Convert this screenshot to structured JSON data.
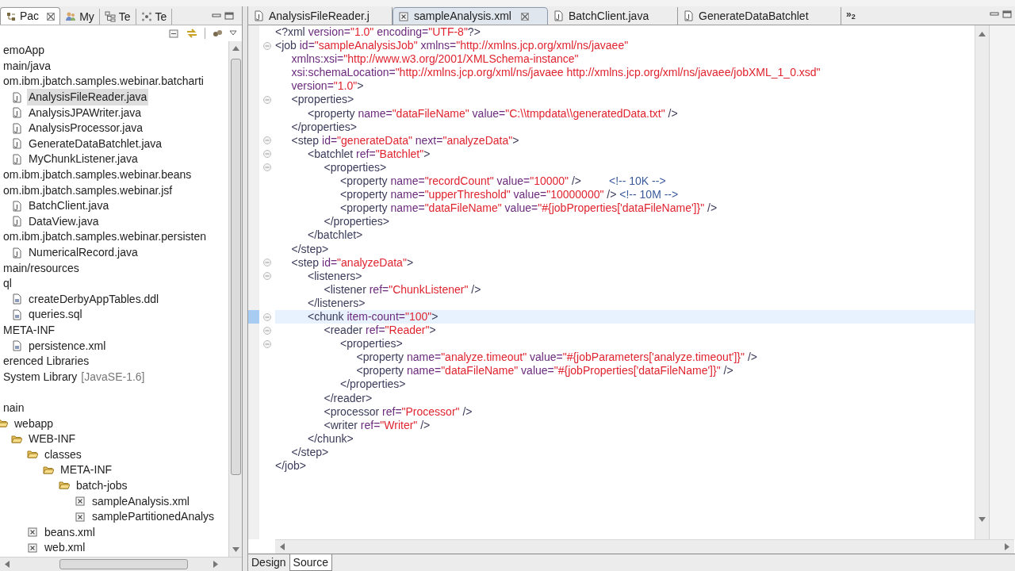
{
  "explorer": {
    "tabs": [
      {
        "label": "Pac",
        "kind": "package",
        "selected": true
      },
      {
        "label": "My",
        "kind": "people",
        "selected": false
      },
      {
        "label": "Te",
        "kind": "hierarchy",
        "selected": false
      },
      {
        "label": "Te",
        "kind": "nodes",
        "selected": false
      }
    ],
    "tree": [
      {
        "text": "emoApp",
        "kind": "plain",
        "selected": false,
        "children": [
          {
            "text": "main/java",
            "kind": "plain",
            "selected": false,
            "children": [
              {
                "text": "om.ibm.jbatch.samples.webinar.batcharti",
                "kind": "plain",
                "selected": false,
                "children": [
                  {
                    "text": "AnalysisFileReader.java",
                    "kind": "java",
                    "selected": true
                  },
                  {
                    "text": "AnalysisJPAWriter.java",
                    "kind": "java",
                    "selected": false
                  },
                  {
                    "text": "AnalysisProcessor.java",
                    "kind": "java",
                    "selected": false
                  },
                  {
                    "text": "GenerateDataBatchlet.java",
                    "kind": "java",
                    "selected": false
                  },
                  {
                    "text": "MyChunkListener.java",
                    "kind": "java",
                    "selected": false
                  }
                ]
              },
              {
                "text": "om.ibm.jbatch.samples.webinar.beans",
                "kind": "plain",
                "selected": false
              },
              {
                "text": "om.ibm.jbatch.samples.webinar.jsf",
                "kind": "plain",
                "selected": false,
                "children": [
                  {
                    "text": "BatchClient.java",
                    "kind": "java",
                    "selected": false
                  },
                  {
                    "text": "DataView.java",
                    "kind": "java",
                    "selected": false
                  }
                ]
              },
              {
                "text": "om.ibm.jbatch.samples.webinar.persisten",
                "kind": "plain",
                "selected": false,
                "children": [
                  {
                    "text": "NumericalRecord.java",
                    "kind": "java",
                    "selected": false
                  }
                ]
              }
            ]
          },
          {
            "text": "main/resources",
            "kind": "plain",
            "selected": false,
            "children": [
              {
                "text": "ql",
                "kind": "plain",
                "selected": false,
                "children": [
                  {
                    "text": "createDerbyAppTables.ddl",
                    "kind": "script",
                    "selected": false
                  },
                  {
                    "text": "queries.sql",
                    "kind": "script",
                    "selected": false
                  }
                ]
              },
              {
                "text": "META-INF",
                "kind": "plain",
                "selected": false,
                "children": [
                  {
                    "text": "persistence.xml",
                    "kind": "script",
                    "selected": false
                  }
                ]
              }
            ]
          }
        ]
      },
      {
        "text": "erenced Libraries",
        "kind": "plain",
        "selected": false
      },
      {
        "text": "System Library",
        "decoration": "[JavaSE-1.6]",
        "kind": "plain",
        "selected": false
      },
      {
        "kind": "clipped",
        "selected": false,
        "children": [
          {
            "text": "nain",
            "kind": "plain",
            "selected": false,
            "children": [
              {
                "text": "webapp",
                "kind": "folder",
                "selected": false,
                "children": [
                  {
                    "text": "WEB-INF",
                    "kind": "folder",
                    "selected": false,
                    "children": [
                      {
                        "text": "classes",
                        "kind": "folder",
                        "selected": false,
                        "children": [
                          {
                            "text": "META-INF",
                            "kind": "folder",
                            "selected": false,
                            "children": [
                              {
                                "text": "batch-jobs",
                                "kind": "folder",
                                "selected": false,
                                "children": [
                                  {
                                    "text": "sampleAnalysis.xml",
                                    "kind": "xml",
                                    "selected": false
                                  },
                                  {
                                    "text": "samplePartitionedAnalys",
                                    "kind": "xml",
                                    "selected": false
                                  }
                                ]
                              }
                            ]
                          }
                        ]
                      },
                      {
                        "text": "beans.xml",
                        "kind": "xml",
                        "selected": false
                      },
                      {
                        "text": "web.xml",
                        "kind": "xml",
                        "selected": false
                      }
                    ]
                  }
                ]
              }
            ]
          }
        ]
      }
    ]
  },
  "editor": {
    "tabs": [
      {
        "label": "AnalysisFileReader.j",
        "kind": "java",
        "selected": false
      },
      {
        "label": "sampleAnalysis.xml",
        "kind": "xml",
        "selected": true
      },
      {
        "label": "BatchClient.java",
        "kind": "java",
        "selected": false
      },
      {
        "label": "GenerateDataBatchlet",
        "kind": "java",
        "selected": false
      }
    ],
    "overflow": "»$_{2}$",
    "lines": [
      {
        "fold": false,
        "current": false,
        "parts": [
          {
            "kind": "tag",
            "text": "<?xml "
          },
          {
            "kind": "attr",
            "text": "version="
          },
          {
            "kind": "value",
            "text": "\"1.0\""
          },
          {
            "kind": "attr",
            "text": " encoding="
          },
          {
            "kind": "value",
            "text": "\"UTF-8\""
          },
          {
            "kind": "tag",
            "text": "?>"
          }
        ]
      },
      {
        "fold": true,
        "current": false,
        "parts": [
          {
            "kind": "tag",
            "text": "<job "
          },
          {
            "kind": "attr",
            "text": "id="
          },
          {
            "kind": "value",
            "text": "\"sampleAnalysisJob\""
          },
          {
            "kind": "attr",
            "text": " xmlns="
          },
          {
            "kind": "value",
            "text": "\"http://xmlns.jcp.org/xml/ns/javaee\""
          }
        ]
      },
      {
        "fold": false,
        "current": false,
        "parts": [
          {
            "kind": "attr",
            "text": "\txmlns:xsi="
          },
          {
            "kind": "value",
            "text": "\"http://www.w3.org/2001/XMLSchema-instance\""
          }
        ]
      },
      {
        "fold": false,
        "current": false,
        "parts": [
          {
            "kind": "attr",
            "text": "\txsi:schemaLocation="
          },
          {
            "kind": "value",
            "text": "\"http://xmlns.jcp.org/xml/ns/javaee http://xmlns.jcp.org/xml/ns/javaee/jobXML_1_0.xsd\""
          }
        ]
      },
      {
        "fold": false,
        "current": false,
        "parts": [
          {
            "kind": "attr",
            "text": "\tversion="
          },
          {
            "kind": "value",
            "text": "\"1.0\""
          },
          {
            "kind": "tag",
            "text": ">"
          }
        ]
      },
      {
        "fold": true,
        "current": false,
        "parts": [
          {
            "kind": "tag",
            "text": "\t<properties>"
          }
        ]
      },
      {
        "fold": false,
        "current": false,
        "parts": [
          {
            "kind": "tag",
            "text": "\t\t<property "
          },
          {
            "kind": "attr",
            "text": "name="
          },
          {
            "kind": "value",
            "text": "\"dataFileName\""
          },
          {
            "kind": "attr",
            "text": " value="
          },
          {
            "kind": "value",
            "text": "\"C:\\\\tmpdata\\\\generatedData.txt\""
          },
          {
            "kind": "tag",
            "text": " />"
          }
        ]
      },
      {
        "fold": false,
        "current": false,
        "parts": [
          {
            "kind": "tag",
            "text": "\t</properties>"
          }
        ]
      },
      {
        "fold": true,
        "current": false,
        "parts": [
          {
            "kind": "tag",
            "text": "\t<step "
          },
          {
            "kind": "attr",
            "text": "id="
          },
          {
            "kind": "value",
            "text": "\"generateData\""
          },
          {
            "kind": "attr",
            "text": " next="
          },
          {
            "kind": "value",
            "text": "\"analyzeData\""
          },
          {
            "kind": "tag",
            "text": ">"
          }
        ]
      },
      {
        "fold": true,
        "current": false,
        "parts": [
          {
            "kind": "tag",
            "text": "\t\t<batchlet "
          },
          {
            "kind": "attr",
            "text": "ref="
          },
          {
            "kind": "value",
            "text": "\"Batchlet\""
          },
          {
            "kind": "tag",
            "text": ">"
          }
        ]
      },
      {
        "fold": true,
        "current": false,
        "parts": [
          {
            "kind": "tag",
            "text": "\t\t\t<properties>"
          }
        ]
      },
      {
        "fold": false,
        "current": false,
        "parts": [
          {
            "kind": "tag",
            "text": "\t\t\t\t<property "
          },
          {
            "kind": "attr",
            "text": "name="
          },
          {
            "kind": "value",
            "text": "\"recordCount\""
          },
          {
            "kind": "attr",
            "text": " value="
          },
          {
            "kind": "value",
            "text": "\"10000\""
          },
          {
            "kind": "tag",
            "text": " />"
          },
          {
            "kind": "comment",
            "text": "         <!-- 10K -->"
          }
        ]
      },
      {
        "fold": false,
        "current": false,
        "parts": [
          {
            "kind": "tag",
            "text": "\t\t\t\t<property "
          },
          {
            "kind": "attr",
            "text": "name="
          },
          {
            "kind": "value",
            "text": "\"upperThreshold\""
          },
          {
            "kind": "attr",
            "text": " value="
          },
          {
            "kind": "value",
            "text": "\"10000000\""
          },
          {
            "kind": "tag",
            "text": " />"
          },
          {
            "kind": "comment",
            "text": " <!-- 10M -->"
          }
        ]
      },
      {
        "fold": false,
        "current": false,
        "parts": [
          {
            "kind": "tag",
            "text": "\t\t\t\t<property "
          },
          {
            "kind": "attr",
            "text": "name="
          },
          {
            "kind": "value",
            "text": "\"dataFileName\""
          },
          {
            "kind": "attr",
            "text": " value="
          },
          {
            "kind": "value",
            "text": "\"#{jobProperties['dataFileName']}\""
          },
          {
            "kind": "tag",
            "text": " />"
          }
        ]
      },
      {
        "fold": false,
        "current": false,
        "parts": [
          {
            "kind": "tag",
            "text": "\t\t\t</properties>"
          }
        ]
      },
      {
        "fold": false,
        "current": false,
        "parts": [
          {
            "kind": "tag",
            "text": "\t\t</batchlet>"
          }
        ]
      },
      {
        "fold": false,
        "current": false,
        "parts": [
          {
            "kind": "tag",
            "text": "\t</step>"
          }
        ]
      },
      {
        "fold": true,
        "current": false,
        "parts": [
          {
            "kind": "tag",
            "text": "\t<step "
          },
          {
            "kind": "attr",
            "text": "id="
          },
          {
            "kind": "value",
            "text": "\"analyzeData\""
          },
          {
            "kind": "tag",
            "text": ">"
          }
        ]
      },
      {
        "fold": true,
        "current": false,
        "parts": [
          {
            "kind": "tag",
            "text": "\t\t<listeners>"
          }
        ]
      },
      {
        "fold": false,
        "current": false,
        "parts": [
          {
            "kind": "tag",
            "text": "\t\t\t<listener "
          },
          {
            "kind": "attr",
            "text": "ref="
          },
          {
            "kind": "value",
            "text": "\"ChunkListener\""
          },
          {
            "kind": "tag",
            "text": " />"
          }
        ]
      },
      {
        "fold": false,
        "current": false,
        "parts": [
          {
            "kind": "tag",
            "text": "\t\t</listeners>"
          }
        ]
      },
      {
        "fold": true,
        "current": true,
        "parts": [
          {
            "kind": "tag",
            "text": "\t\t<chunk "
          },
          {
            "kind": "attr",
            "text": "item-count="
          },
          {
            "kind": "value",
            "text": "\"100\""
          },
          {
            "kind": "tag",
            "text": ">"
          }
        ]
      },
      {
        "fold": true,
        "current": false,
        "parts": [
          {
            "kind": "tag",
            "text": "\t\t\t<reader "
          },
          {
            "kind": "attr",
            "text": "ref="
          },
          {
            "kind": "value",
            "text": "\"Reader\""
          },
          {
            "kind": "tag",
            "text": ">"
          }
        ]
      },
      {
        "fold": true,
        "current": false,
        "parts": [
          {
            "kind": "tag",
            "text": "\t\t\t\t<properties>"
          }
        ]
      },
      {
        "fold": false,
        "current": false,
        "parts": [
          {
            "kind": "tag",
            "text": "\t\t\t\t\t<property "
          },
          {
            "kind": "attr",
            "text": "name="
          },
          {
            "kind": "value",
            "text": "\"analyze.timeout\""
          },
          {
            "kind": "attr",
            "text": " value="
          },
          {
            "kind": "value",
            "text": "\"#{jobParameters['analyze.timeout']}\""
          },
          {
            "kind": "tag",
            "text": " />"
          }
        ]
      },
      {
        "fold": false,
        "current": false,
        "parts": [
          {
            "kind": "tag",
            "text": "\t\t\t\t\t<property "
          },
          {
            "kind": "attr",
            "text": "name="
          },
          {
            "kind": "value",
            "text": "\"dataFileName\""
          },
          {
            "kind": "attr",
            "text": " value="
          },
          {
            "kind": "value",
            "text": "\"#{jobProperties['dataFileName']}\""
          },
          {
            "kind": "tag",
            "text": " />"
          }
        ]
      },
      {
        "fold": false,
        "current": false,
        "parts": [
          {
            "kind": "tag",
            "text": "\t\t\t\t</properties>"
          }
        ]
      },
      {
        "fold": false,
        "current": false,
        "parts": [
          {
            "kind": "tag",
            "text": "\t\t\t</reader>"
          }
        ]
      },
      {
        "fold": false,
        "current": false,
        "parts": [
          {
            "kind": "tag",
            "text": "\t\t\t<processor "
          },
          {
            "kind": "attr",
            "text": "ref="
          },
          {
            "kind": "value",
            "text": "\"Processor\""
          },
          {
            "kind": "tag",
            "text": " />"
          }
        ]
      },
      {
        "fold": false,
        "current": false,
        "parts": [
          {
            "kind": "tag",
            "text": "\t\t\t<writer "
          },
          {
            "kind": "attr",
            "text": "ref="
          },
          {
            "kind": "value",
            "text": "\"Writer\""
          },
          {
            "kind": "tag",
            "text": " />"
          }
        ]
      },
      {
        "fold": false,
        "current": false,
        "parts": [
          {
            "kind": "tag",
            "text": "\t\t</chunk>"
          }
        ]
      },
      {
        "fold": false,
        "current": false,
        "parts": [
          {
            "kind": "tag",
            "text": "\t</step>"
          }
        ]
      },
      {
        "fold": false,
        "current": false,
        "parts": [
          {
            "kind": "tag",
            "text": "</job>"
          }
        ]
      }
    ],
    "bottom_tabs": [
      {
        "label": "Design",
        "selected": false
      },
      {
        "label": "Source",
        "selected": true
      }
    ]
  }
}
